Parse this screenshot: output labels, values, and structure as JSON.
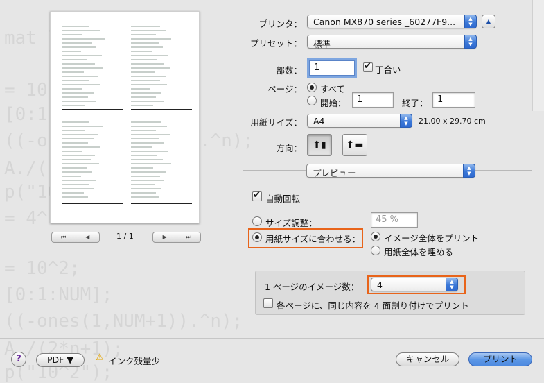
{
  "background_code": [
    "mat l",
    "= 10",
    "[0:1",
    "((-o             ).^n);",
    "A./(",
    "p(\"10",
    "= 4^",
    "= 10^2;",
    "[0:1:NUM];",
    "((-ones(1,NUM+1)).^n);",
    "A./(2*n+1);",
    "p(\"10^2\");"
  ],
  "preview": {
    "page_counter": "1 / 1"
  },
  "printer": {
    "label": "プリンタ：",
    "value": "Canon MX870 series _60277F9..."
  },
  "preset": {
    "label": "プリセット：",
    "value": "標準"
  },
  "copies": {
    "label": "部数：",
    "value": "1",
    "collate_label": "丁合い",
    "collate_checked": true
  },
  "pages": {
    "label": "ページ：",
    "all_label": "すべて",
    "from_label": "開始：",
    "from_value": "1",
    "to_label": "終了：",
    "to_value": "1"
  },
  "paper_size": {
    "label": "用紙サイズ：",
    "value": "A4",
    "dims": "21.00 x 29.70 cm"
  },
  "orientation": {
    "label": "方向："
  },
  "section_popup": {
    "value": "プレビュー"
  },
  "auto_rotate": {
    "label": "自動回転",
    "checked": true
  },
  "scale": {
    "label": "サイズ調整：",
    "value": "45 %"
  },
  "fit": {
    "label": "用紙サイズに合わせる：",
    "print_entire": "イメージ全体をプリント",
    "fill_entire": "用紙全体を埋める"
  },
  "nup": {
    "label": "1 ページのイメージ数：",
    "value": "4",
    "same_content_label": "各ページに、同じ内容を 4 面割り付けでプリント"
  },
  "footer": {
    "help": "?",
    "pdf_label": "PDF ▼",
    "ink_warning": "インク残量少",
    "cancel": "キャンセル",
    "print": "プリント"
  },
  "colors": {
    "accent": "#3b78d8",
    "highlight": "#e8641a"
  }
}
